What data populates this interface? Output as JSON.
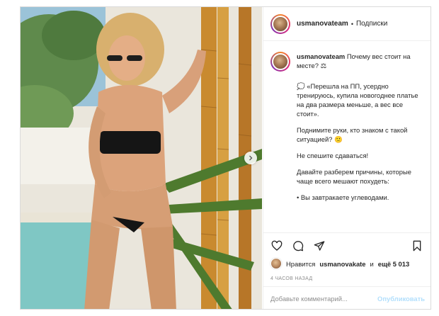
{
  "post": {
    "username": "usmanovateam",
    "header_separator": "•",
    "follow_status": "Подписки",
    "caption": {
      "username": "usmanovateam",
      "title": "Почему вес стоит на месте? ⚖",
      "paragraphs": [
        "💭 «Перешла на ПП, усердно тренируюсь, купила новогоднее платье на два размера меньше, а вес все стоит».",
        "Поднимите руки, кто знаком с такой ситуацией? 🙁",
        "Не спешите сдаваться!",
        "Давайте разберем причины, которые чаще всего мешают похудеть:",
        "• Вы завтракаете углеводами."
      ]
    },
    "likes": {
      "prefix": "Нравится",
      "user": "usmanovakate",
      "conjunction": "и",
      "others": "ещё 5 013"
    },
    "timestamp": "4 часов назад",
    "comment": {
      "placeholder": "Добавьте комментарий...",
      "publish_label": "Опубликовать"
    },
    "icons": {
      "like": "heart-icon",
      "comment": "comment-bubble-icon",
      "share": "paper-plane-icon",
      "save": "bookmark-icon",
      "next": "chevron-right-icon"
    },
    "colors": {
      "publish_disabled": "#b2dffc",
      "muted_text": "#8e8e8e",
      "border": "#dbdbdb"
    }
  }
}
